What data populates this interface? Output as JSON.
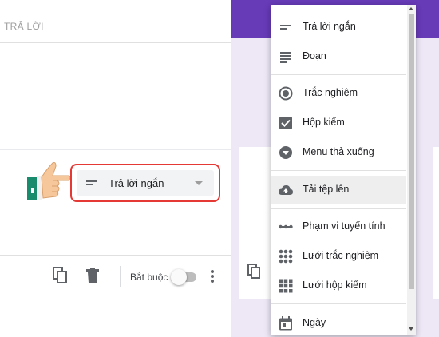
{
  "left": {
    "answer_hint": "TRẢ LỜI",
    "question_type": "Trả lời ngắn",
    "required_label": "Bắt buộc",
    "required_on": false
  },
  "menu": {
    "items": [
      {
        "label": "Trả lời ngắn",
        "icon": "short-answer-icon"
      },
      {
        "label": "Đoạn",
        "icon": "paragraph-icon"
      },
      {
        "label": "Trắc nghiệm",
        "icon": "radio-button-icon"
      },
      {
        "label": "Hộp kiểm",
        "icon": "checkbox-icon"
      },
      {
        "label": "Menu thả xuống",
        "icon": "dropdown-icon"
      },
      {
        "label": "Tải tệp lên",
        "icon": "cloud-upload-icon"
      },
      {
        "label": "Phạm vi tuyến tính",
        "icon": "linear-scale-icon"
      },
      {
        "label": "Lưới trắc nghiệm",
        "icon": "radio-grid-icon"
      },
      {
        "label": "Lưới hộp kiểm",
        "icon": "checkbox-grid-icon"
      },
      {
        "label": "Ngày",
        "icon": "calendar-icon"
      }
    ],
    "highlighted": "Tải tệp lên"
  },
  "colors": {
    "header_purple": "#673ab7",
    "background_lavender": "#ede7f6",
    "highlight_border": "#e53935"
  }
}
